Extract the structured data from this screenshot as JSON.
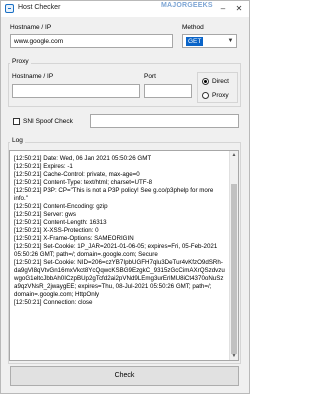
{
  "window": {
    "title": "Host Checker",
    "watermark": "MAJORGEEKS"
  },
  "hostname": {
    "label": "Hostname / IP",
    "value": "www.google.com"
  },
  "method": {
    "label": "Method",
    "value": "GET"
  },
  "proxy": {
    "group_label": "Proxy",
    "host_label": "Hostname / IP",
    "host_value": "",
    "port_label": "Port",
    "port_value": "",
    "options": [
      {
        "label": "Direct",
        "checked": true
      },
      {
        "label": "Proxy",
        "checked": false
      }
    ]
  },
  "sni": {
    "label": "SNI Spoof Check",
    "checked": false,
    "value": ""
  },
  "log": {
    "label": "Log",
    "lines": [
      "[12:50:21] Date: Wed, 06 Jan 2021 05:50:26 GMT",
      "[12:50:21] Expires: -1",
      "[12:50:21] Cache-Control: private, max-age=0",
      "[12:50:21] Content-Type: text/html; charset=UTF-8",
      "[12:50:21] P3P: CP=\"This is not a P3P policy! See g.co/p3phelp for more info.\"",
      "[12:50:21] Content-Encoding: gzip",
      "[12:50:21] Server: gws",
      "[12:50:21] Content-Length: 16313",
      "[12:50:21] X-XSS-Protection: 0",
      "[12:50:21] X-Frame-Options: SAMEORIGIN",
      "[12:50:21] Set-Cookie: 1P_JAR=2021-01-06-05; expires=Fri, 05-Feb-2021 05:50:26 GMT; path=/; domain=.google.com; Secure",
      "[12:50:21] Set-Cookie: NID=206=czYB7IpbUGFH7qlu3DeTur4vKfzO9dSRh-da9gVI8qVtvGn16mxVkct8YcQqwcKSBG9EzgkC_9315zGcCimAXrQSzdvzuwgoG1eltcJbbAh0ICzpBUp2gTcfd2ai2pVNd9LEmg3urErlMU8iCt4370oNuSza9qzVNsR_2jwaygEE; expires=Thu, 08-Jul-2021 05:50:26 GMT; path=/; domain=.google.com; HttpOnly",
      "[12:50:21] Connection: close"
    ]
  },
  "check_button": {
    "label": "Check"
  }
}
